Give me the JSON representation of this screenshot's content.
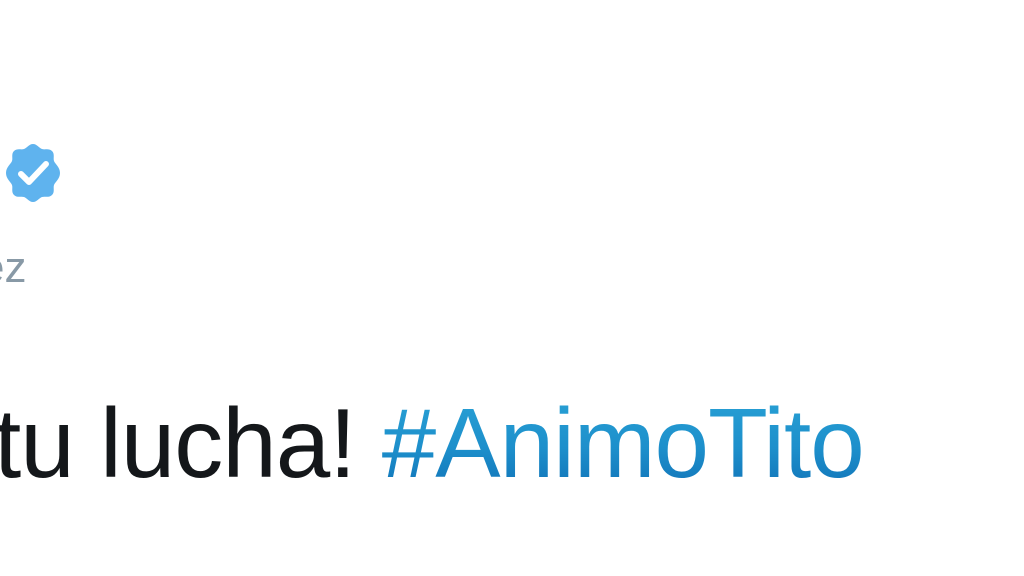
{
  "author": {
    "handle_partial": "ez",
    "verified": true,
    "badge_icon": "verified-badge-icon"
  },
  "tweet": {
    "text_partial": "tu lucha! ",
    "hashtag_partial": "#AnimoTito"
  },
  "colors": {
    "badge": "#5fb3ee",
    "handle": "#8899a6",
    "text": "#14171a",
    "hashtag": "#1b8ccc"
  }
}
